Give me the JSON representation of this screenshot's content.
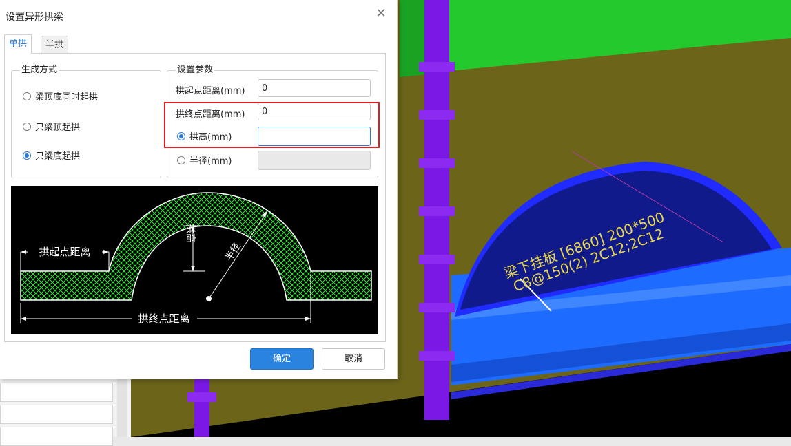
{
  "dialog": {
    "title": "设置异形拱梁",
    "close_icon": "close-icon",
    "tabs": [
      {
        "label": "单拱",
        "active": true
      },
      {
        "label": "半拱",
        "active": false
      }
    ],
    "generation": {
      "legend": "生成方式",
      "options": [
        {
          "label": "梁顶底同时起拱",
          "checked": false
        },
        {
          "label": "只梁顶起拱",
          "checked": false
        },
        {
          "label": "只梁底起拱",
          "checked": true
        }
      ]
    },
    "params": {
      "legend": "设置参数",
      "start_label": "拱起点距离(mm)",
      "start_value": "0",
      "end_label": "拱终点距离(mm)",
      "end_value": "0",
      "height_label": "拱高(mm)",
      "height_value": "",
      "height_checked": true,
      "radius_label": "半径(mm)",
      "radius_value": "",
      "radius_checked": false
    },
    "diagram": {
      "start_label": "拱起点距离",
      "end_label": "拱终点距离",
      "height_label": "拱高",
      "radius_label": "半径"
    },
    "ok_label": "确定",
    "cancel_label": "取消"
  },
  "viewport": {
    "annotation_line1": "梁下挂板 [6860] 200*500",
    "annotation_line2": "C8@150(2) 2C12;2C12",
    "colors": {
      "wall": "#6b6419",
      "green_beam": "#24c92e",
      "purple_column": "#7a18e6",
      "blue_beam": "#1e6bff",
      "arch_fill": "#101a8a",
      "arch_edge": "#1f2bff",
      "text": "#e8d64b"
    }
  }
}
